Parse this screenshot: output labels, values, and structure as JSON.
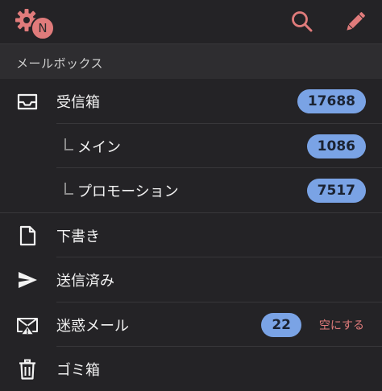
{
  "header": {
    "account_initial": "N",
    "icons": {
      "settings": "gear-icon",
      "search": "search-icon",
      "compose": "pencil-icon"
    }
  },
  "section": {
    "title": "メールボックス"
  },
  "mailboxes": [
    {
      "label": "受信箱",
      "count": "17688",
      "icon": "inbox-icon"
    },
    {
      "label": "メイン",
      "count": "1086"
    },
    {
      "label": "プロモーション",
      "count": "7517"
    },
    {
      "label": "下書き",
      "icon": "draft-icon"
    },
    {
      "label": "送信済み",
      "icon": "send-icon"
    },
    {
      "label": "迷惑メール",
      "count": "22",
      "action": "空にする",
      "icon": "spam-icon"
    },
    {
      "label": "ゴミ箱",
      "icon": "trash-icon"
    }
  ],
  "colors": {
    "accent": "#e07b7b",
    "badge": "#7aa3e5",
    "background": "#242326"
  }
}
